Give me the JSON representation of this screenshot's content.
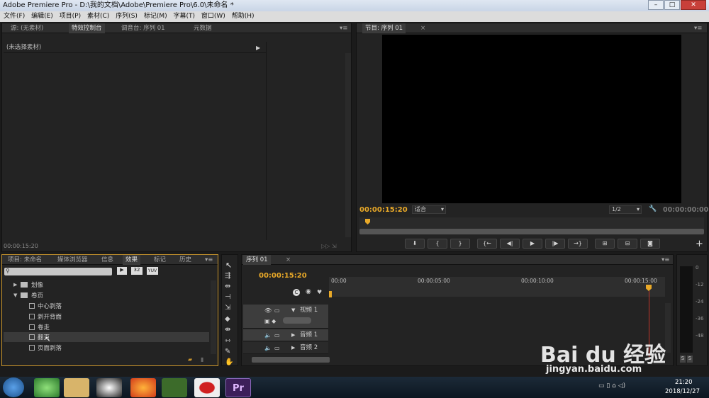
{
  "window": {
    "title": "Adobe Premiere Pro - D:\\我的文档\\Adobe\\Premiere Pro\\6.0\\未命名 *",
    "min": "–",
    "max": "□",
    "close": "✕"
  },
  "menu": [
    "文件(F)",
    "编辑(E)",
    "项目(P)",
    "素材(C)",
    "序列(S)",
    "标记(M)",
    "字幕(T)",
    "窗口(W)",
    "帮助(H)"
  ],
  "source_panel": {
    "tabs": [
      "源: (无素材)",
      "特效控制台",
      "调音台: 序列 01",
      "元数据"
    ],
    "no_clip": "(未选择素材)",
    "timecode": "00:00:15:20"
  },
  "program_monitor": {
    "tab": "节目: 序列 01",
    "timecode": "00:00:15:20",
    "fit": "适合",
    "resolution": "1/2",
    "end_timecode": "00:00:00:00"
  },
  "project_panel": {
    "tabs": [
      "项目: 未命名",
      "媒体浏览器",
      "信息",
      "效果",
      "标记",
      "历史"
    ],
    "badges": [
      "32",
      "YUV"
    ]
  },
  "effects_tree": {
    "folder1": "划像",
    "folder2": "卷页",
    "items": [
      "中心剥落",
      "剥开背面",
      "卷走",
      "翻页",
      "页面剥落"
    ]
  },
  "timeline": {
    "tab": "序列 01",
    "timecode": "00:00:15:20",
    "ruler": [
      "00:00",
      "00:00:05:00",
      "00:00:10:00",
      "00:00:15:00"
    ],
    "tracks": {
      "video1": "视频 1",
      "audio1": "音频 1",
      "audio2": "音频 2"
    }
  },
  "audio_meter": {
    "labels": [
      "0",
      "-12",
      "-24",
      "-36",
      "-48"
    ],
    "solo": [
      "S",
      "S"
    ]
  },
  "taskbar": {
    "time": "21:20",
    "date": "2018/12/27"
  },
  "watermark": {
    "brand": "Bai du 经验",
    "url": "jingyan.baidu.com"
  },
  "colors": {
    "accent": "#e9a928",
    "playhead": "#c0352a",
    "panel": "#232323"
  }
}
